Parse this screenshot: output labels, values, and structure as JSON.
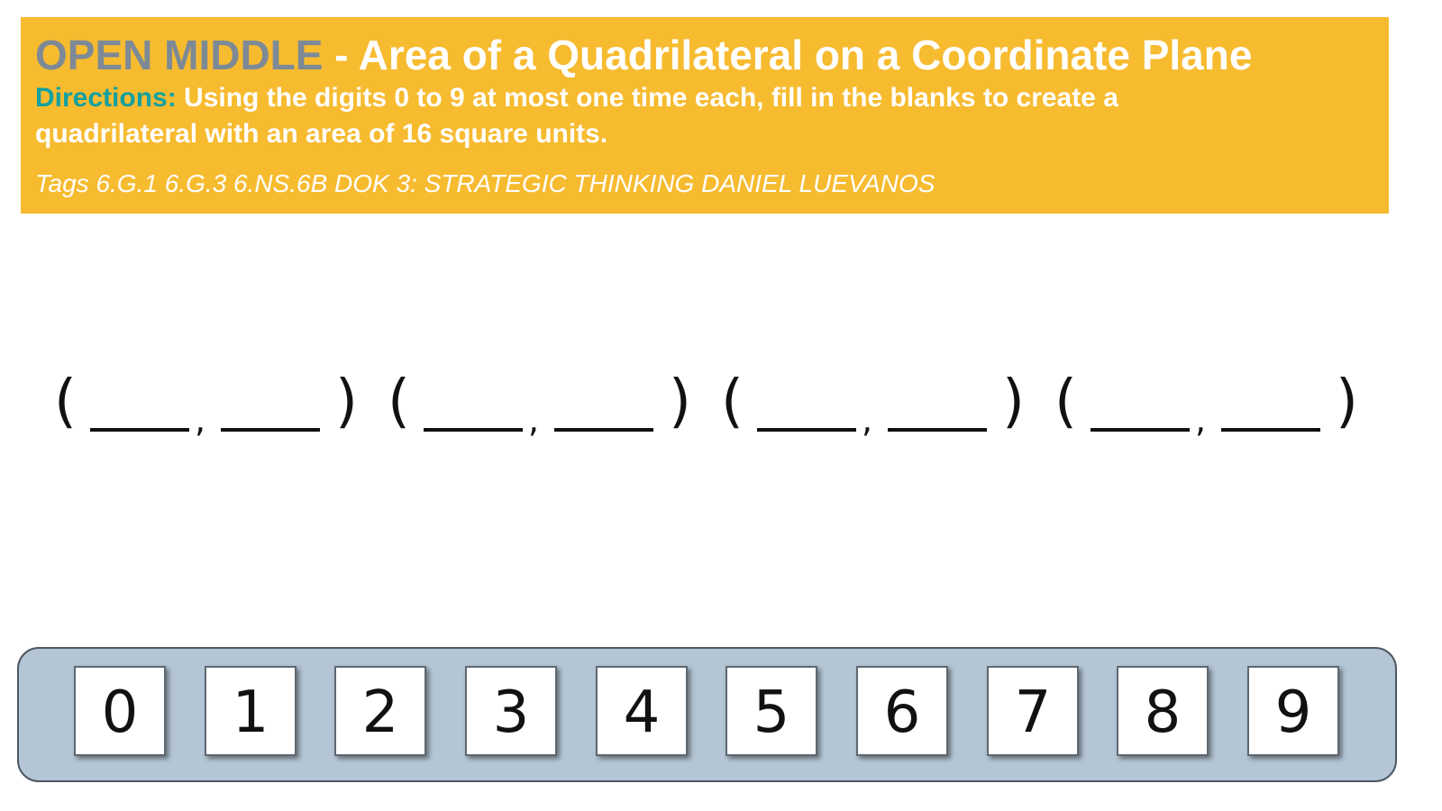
{
  "header": {
    "title_brand": "OPEN MIDDLE",
    "title_rest": " - Area of a Quadrilateral on a Coordinate Plane",
    "directions_label": "Directions:",
    "directions_text": " Using the digits 0 to 9 at most one time each, fill in the blanks to create a quadrilateral with an area of 16 square units.",
    "tags": "Tags 6.G.1 6.G.3 6.NS.6B DOK 3: STRATEGIC THINKING  DANIEL LUEVANOS",
    "colors": {
      "background": "#f7bb30",
      "brand": "#7d8a96",
      "directions_label": "#12a0a0",
      "text": "#ffffff"
    }
  },
  "coordinates": {
    "open": "(",
    "close": ")",
    "separator": ","
  },
  "digits": [
    "0",
    "1",
    "2",
    "3",
    "4",
    "5",
    "6",
    "7",
    "8",
    "9"
  ],
  "tray": {
    "background": "#b4c6d5"
  }
}
